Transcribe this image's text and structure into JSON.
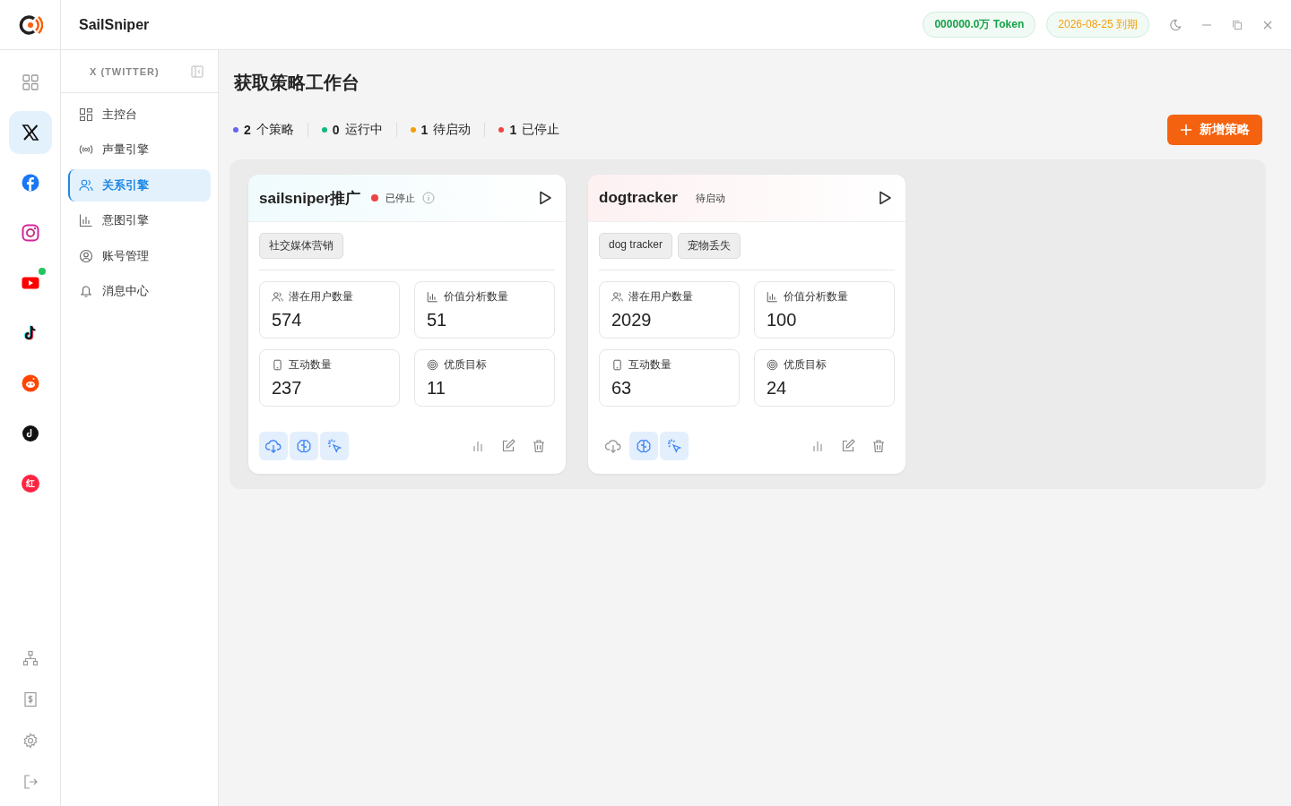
{
  "app": {
    "name": "SailSniper"
  },
  "header": {
    "token_badge": "000000.0万 Token",
    "expiry_badge": "2026-08-25 到期"
  },
  "rail": [
    {
      "kind": "grid",
      "selected": false,
      "notify": false
    },
    {
      "kind": "x",
      "selected": true,
      "notify": false
    },
    {
      "kind": "facebook",
      "selected": false,
      "notify": false
    },
    {
      "kind": "instagram",
      "selected": false,
      "notify": false
    },
    {
      "kind": "youtube",
      "selected": false,
      "notify": true
    },
    {
      "kind": "tiktok",
      "selected": false,
      "notify": false
    },
    {
      "kind": "reddit",
      "selected": false,
      "notify": false
    },
    {
      "kind": "disc",
      "selected": false,
      "notify": false
    },
    {
      "kind": "redbook",
      "selected": false,
      "notify": false,
      "mark": "红"
    }
  ],
  "rail_bottom": [
    {
      "kind": "org"
    },
    {
      "kind": "bill"
    },
    {
      "kind": "gear"
    },
    {
      "kind": "logout"
    }
  ],
  "sidebar": {
    "title": "X (TWITTER)",
    "items": [
      {
        "label": "主控台",
        "kind": "grid",
        "selected": false
      },
      {
        "label": "声量引擎",
        "kind": "signal",
        "selected": false
      },
      {
        "label": "关系引擎",
        "kind": "users",
        "selected": true
      },
      {
        "label": "意图引擎",
        "kind": "bars",
        "selected": false
      },
      {
        "label": "账号管理",
        "kind": "account",
        "selected": false
      },
      {
        "label": "消息中心",
        "kind": "bell",
        "selected": false
      }
    ]
  },
  "page": {
    "title": "获取策略工作台",
    "add_button": "新增策略",
    "stats": [
      {
        "count": "2",
        "label": "个策略",
        "color": "#6366f1"
      },
      {
        "count": "0",
        "label": "运行中",
        "color": "#10b981"
      },
      {
        "count": "1",
        "label": "待启动",
        "color": "#f59e0b"
      },
      {
        "count": "1",
        "label": "已停止",
        "color": "#ef4444"
      }
    ]
  },
  "strategies": [
    {
      "name": "sailsniper推广",
      "status": {
        "kind": "stopped",
        "label": "已停止"
      },
      "tags": [
        "社交媒体营销"
      ],
      "metrics": [
        {
          "kind": "users",
          "label": "潜在用户数量",
          "value": "574"
        },
        {
          "kind": "bars",
          "label": "价值分析数量",
          "value": "51"
        },
        {
          "kind": "phone",
          "label": "互动数量",
          "value": "237"
        },
        {
          "kind": "target",
          "label": "优质目标",
          "value": "11"
        }
      ],
      "tools": [
        {
          "kind": "cloud",
          "on": true
        },
        {
          "kind": "brain",
          "on": true
        },
        {
          "kind": "click",
          "on": true
        }
      ]
    },
    {
      "name": "dogtracker",
      "status": {
        "kind": "pending",
        "label": "待启动"
      },
      "tags": [
        "dog tracker",
        "宠物丢失"
      ],
      "metrics": [
        {
          "kind": "users",
          "label": "潜在用户数量",
          "value": "2029"
        },
        {
          "kind": "bars",
          "label": "价值分析数量",
          "value": "100"
        },
        {
          "kind": "phone",
          "label": "互动数量",
          "value": "63"
        },
        {
          "kind": "target",
          "label": "优质目标",
          "value": "24"
        }
      ],
      "tools": [
        {
          "kind": "cloud",
          "on": false
        },
        {
          "kind": "brain",
          "on": true
        },
        {
          "kind": "click",
          "on": true
        }
      ]
    }
  ]
}
